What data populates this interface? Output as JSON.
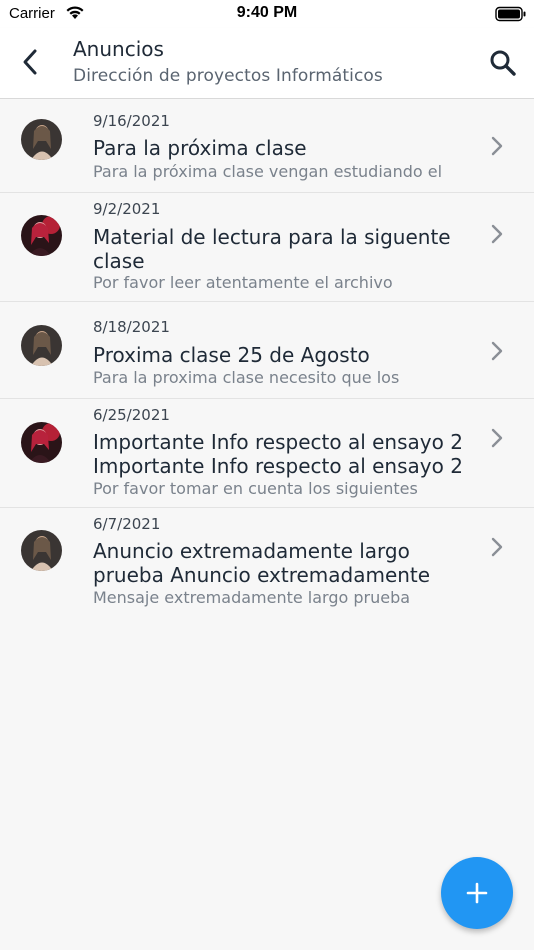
{
  "status_bar": {
    "carrier": "Carrier",
    "time": "9:40 PM"
  },
  "header": {
    "title": "Anuncios",
    "subtitle": "Dirección de proyectos Informáticos"
  },
  "colors": {
    "accent": "#2196f3",
    "text_primary": "#1f2a37",
    "text_secondary": "#7a828c",
    "background": "#f7f7f7"
  },
  "announcements": [
    {
      "date": "9/16/2021",
      "title": "Para la próxima clase",
      "preview": "Para la próxima clase vengan estudiando el",
      "avatar": "avatar-dark"
    },
    {
      "date": "9/2/2021",
      "title": "Material de lectura para la siguente clase",
      "preview": "Por favor leer atentamente el archivo",
      "avatar": "avatar-red"
    },
    {
      "date": "8/18/2021",
      "title": "Proxima clase 25 de Agosto",
      "preview": "Para la proxima clase necesito que los",
      "avatar": "avatar-dark"
    },
    {
      "date": "6/25/2021",
      "title": "Importante Info respecto al ensayo 2 Importante Info respecto al ensayo 2",
      "preview": "Por favor tomar en cuenta los siguientes",
      "avatar": "avatar-red"
    },
    {
      "date": "6/7/2021",
      "title": "Anuncio extremadamente largo prueba Anuncio extremadamente",
      "preview": "Mensaje extremadamente largo prueba",
      "avatar": "avatar-dark"
    }
  ],
  "fab": {
    "icon": "plus-icon"
  }
}
